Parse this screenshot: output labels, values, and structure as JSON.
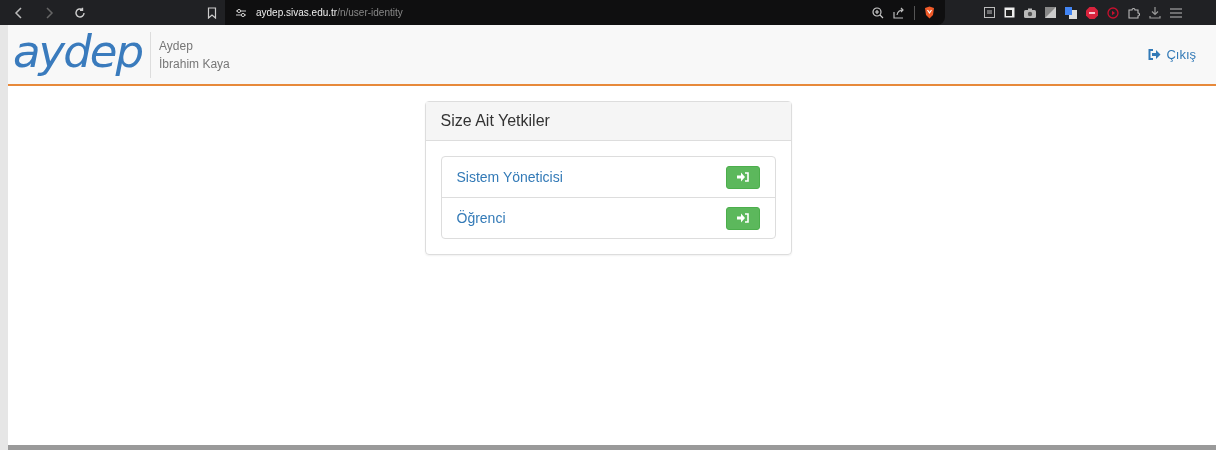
{
  "browser": {
    "url_host": "aydep.sivas.edu.tr",
    "url_path": "/n/user-identity"
  },
  "header": {
    "logo": "aydep",
    "app_name": "Aydep",
    "user_name": "İbrahim Kaya",
    "logout": "Çıkış"
  },
  "panel": {
    "title": "Size Ait Yetkiler",
    "roles": [
      {
        "label": "Sistem Yöneticisi"
      },
      {
        "label": "Öğrenci"
      }
    ]
  }
}
